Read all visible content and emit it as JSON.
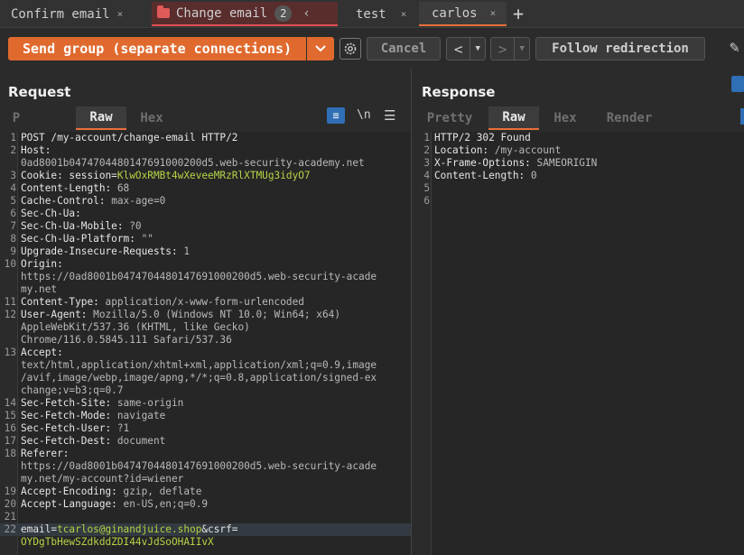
{
  "tabs": [
    {
      "label": "Confirm email",
      "close": "×"
    },
    {
      "label": "Change email",
      "badge": "2",
      "chevron": "‹"
    },
    {
      "label": "test",
      "close": "×"
    },
    {
      "label": "carlos",
      "close": "×",
      "selected": true
    }
  ],
  "new_tab": "+",
  "toolbar": {
    "send_label": "Send group (separate connections)",
    "cancel_label": "Cancel",
    "back_glyph": "<",
    "forward_glyph": ">",
    "follow_label": "Follow redirection"
  },
  "request": {
    "title": "Request",
    "tabs": [
      "P",
      "Raw",
      "Hex"
    ],
    "selected_tab": "Raw",
    "newline_glyph": "\\n",
    "lines": [
      {
        "n": "1",
        "parts": [
          {
            "t": "POST /my-account/change-email HTTP/2",
            "c": "hk"
          }
        ]
      },
      {
        "n": "2",
        "parts": [
          {
            "t": "Host:",
            "c": "hk"
          }
        ]
      },
      {
        "n": "",
        "parts": [
          {
            "t": "0ad8001b04747044801476910002 00d5.web-security-academy.net",
            "c": "hv"
          }
        ]
      },
      {
        "n": "3",
        "parts": [
          {
            "t": "Cookie: session=",
            "c": "hk"
          },
          {
            "t": "KlwOxRMBt4wXeveeMRzRlXTMUg3idyO7",
            "c": "g"
          }
        ]
      },
      {
        "n": "4",
        "parts": [
          {
            "t": "Content-Length: ",
            "c": "hk"
          },
          {
            "t": "68",
            "c": "hv"
          }
        ]
      },
      {
        "n": "5",
        "parts": [
          {
            "t": "Cache-Control: ",
            "c": "hk"
          },
          {
            "t": "max-age=0",
            "c": "hv"
          }
        ]
      },
      {
        "n": "6",
        "parts": [
          {
            "t": "Sec-Ch-Ua:",
            "c": "hk"
          }
        ]
      },
      {
        "n": "7",
        "parts": [
          {
            "t": "Sec-Ch-Ua-Mobile: ",
            "c": "hk"
          },
          {
            "t": "?0",
            "c": "hv"
          }
        ]
      },
      {
        "n": "8",
        "parts": [
          {
            "t": "Sec-Ch-Ua-Platform: ",
            "c": "hk"
          },
          {
            "t": "\"\"",
            "c": "hv"
          }
        ]
      },
      {
        "n": "9",
        "parts": [
          {
            "t": "Upgrade-Insecure-Requests: ",
            "c": "hk"
          },
          {
            "t": "1",
            "c": "hv"
          }
        ]
      },
      {
        "n": "10",
        "parts": [
          {
            "t": "Origin:",
            "c": "hk"
          }
        ]
      },
      {
        "n": "",
        "parts": [
          {
            "t": "https://0ad8001b0474704480147691000200d5.web-security-acade",
            "c": "hv"
          }
        ]
      },
      {
        "n": "",
        "parts": [
          {
            "t": "my.net",
            "c": "hv"
          }
        ]
      },
      {
        "n": "11",
        "parts": [
          {
            "t": "Content-Type: ",
            "c": "hk"
          },
          {
            "t": "application/x-www-form-urlencoded",
            "c": "hv"
          }
        ]
      },
      {
        "n": "12",
        "parts": [
          {
            "t": "User-Agent: ",
            "c": "hk"
          },
          {
            "t": "Mozilla/5.0 (Windows NT 10.0; Win64; x64)",
            "c": "hv"
          }
        ]
      },
      {
        "n": "",
        "parts": [
          {
            "t": "AppleWebKit/537.36 (KHTML, like Gecko)",
            "c": "hv"
          }
        ]
      },
      {
        "n": "",
        "parts": [
          {
            "t": "Chrome/116.0.5845.111 Safari/537.36",
            "c": "hv"
          }
        ]
      },
      {
        "n": "13",
        "parts": [
          {
            "t": "Accept:",
            "c": "hk"
          }
        ]
      },
      {
        "n": "",
        "parts": [
          {
            "t": "text/html,application/xhtml+xml,application/xml;q=0.9,image",
            "c": "hv"
          }
        ]
      },
      {
        "n": "",
        "parts": [
          {
            "t": "/avif,image/webp,image/apng,*/*;q=0.8,application/signed-ex",
            "c": "hv"
          }
        ]
      },
      {
        "n": "",
        "parts": [
          {
            "t": "change;v=b3;q=0.7",
            "c": "hv"
          }
        ]
      },
      {
        "n": "14",
        "parts": [
          {
            "t": "Sec-Fetch-Site: ",
            "c": "hk"
          },
          {
            "t": "same-origin",
            "c": "hv"
          }
        ]
      },
      {
        "n": "15",
        "parts": [
          {
            "t": "Sec-Fetch-Mode: ",
            "c": "hk"
          },
          {
            "t": "navigate",
            "c": "hv"
          }
        ]
      },
      {
        "n": "16",
        "parts": [
          {
            "t": "Sec-Fetch-User: ",
            "c": "hk"
          },
          {
            "t": "?1",
            "c": "hv"
          }
        ]
      },
      {
        "n": "17",
        "parts": [
          {
            "t": "Sec-Fetch-Dest: ",
            "c": "hk"
          },
          {
            "t": "document",
            "c": "hv"
          }
        ]
      },
      {
        "n": "18",
        "parts": [
          {
            "t": "Referer:",
            "c": "hk"
          }
        ]
      },
      {
        "n": "",
        "parts": [
          {
            "t": "https://0ad8001b0474704480147691000200d5.web-security-acade",
            "c": "hv"
          }
        ]
      },
      {
        "n": "",
        "parts": [
          {
            "t": "my.net/my-account?id=wiener",
            "c": "hv"
          }
        ]
      },
      {
        "n": "19",
        "parts": [
          {
            "t": "Accept-Encoding: ",
            "c": "hk"
          },
          {
            "t": "gzip, deflate",
            "c": "hv"
          }
        ]
      },
      {
        "n": "20",
        "parts": [
          {
            "t": "Accept-Language: ",
            "c": "hk"
          },
          {
            "t": "en-US,en;q=0.9",
            "c": "hv"
          }
        ]
      },
      {
        "n": "21",
        "parts": []
      },
      {
        "n": "22",
        "parts": [
          {
            "t": "email=",
            "c": "hk"
          },
          {
            "t": "tcarlos@ginandjuice.shop",
            "c": "g"
          },
          {
            "t": "&csrf=",
            "c": "hk"
          }
        ],
        "highlight": true
      },
      {
        "n": "",
        "parts": [
          {
            "t": "OYDgTbHewSZdkddZDI44vJdSoOHAIIvX",
            "c": "g"
          }
        ]
      }
    ]
  },
  "response": {
    "title": "Response",
    "tabs": [
      "Pretty",
      "Raw",
      "Hex",
      "Render"
    ],
    "selected_tab": "Raw",
    "lines": [
      {
        "n": "1",
        "parts": [
          {
            "t": "HTTP/2 302 Found",
            "c": "hk"
          }
        ]
      },
      {
        "n": "2",
        "parts": [
          {
            "t": "Location: ",
            "c": "hk"
          },
          {
            "t": "/my-account",
            "c": "hv"
          }
        ]
      },
      {
        "n": "3",
        "parts": [
          {
            "t": "X-Frame-Options: ",
            "c": "hk"
          },
          {
            "t": "SAMEORIGIN",
            "c": "hv"
          }
        ]
      },
      {
        "n": "4",
        "parts": [
          {
            "t": "Content-Length: ",
            "c": "hk"
          },
          {
            "t": "0",
            "c": "hv"
          }
        ]
      },
      {
        "n": "5",
        "parts": []
      },
      {
        "n": "6",
        "parts": []
      }
    ]
  }
}
